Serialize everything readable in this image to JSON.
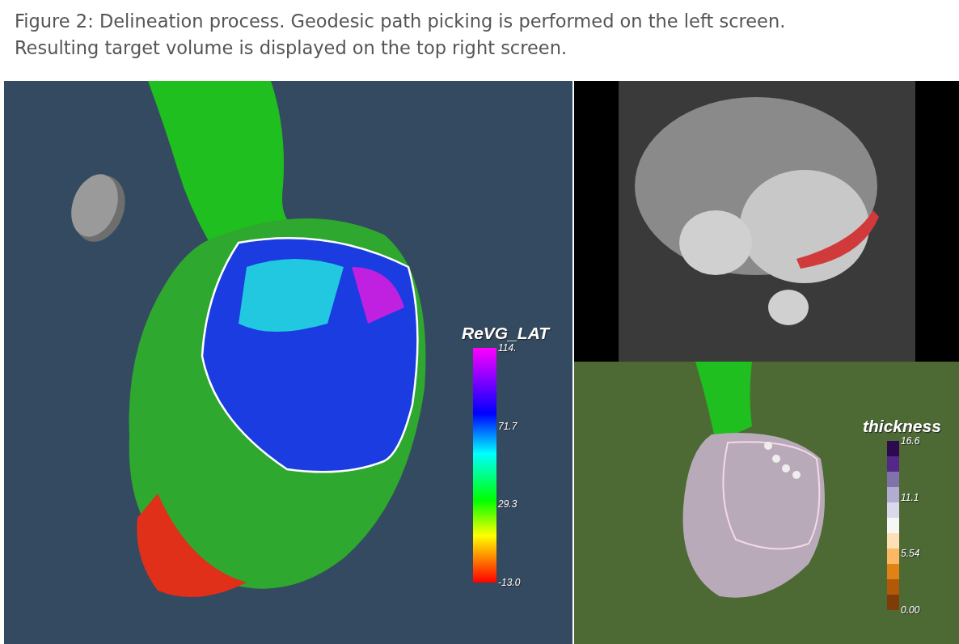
{
  "caption": {
    "lines": [
      "Figure 2: Delineation process. Geodesic path picking is performed on the left screen.",
      "Resulting target volume is displayed on the top right screen."
    ]
  },
  "left_view": {
    "legend": {
      "title": "ReVG_LAT",
      "ticks": [
        "114.",
        "71.7",
        "29.3",
        "-13.0"
      ]
    }
  },
  "bottom_right_view": {
    "legend": {
      "title": "thickness",
      "ticks": [
        "16.6",
        "11.1",
        "5.54",
        "0.00"
      ],
      "bins": [
        {
          "color": "#2d0a4e"
        },
        {
          "color": "#542788"
        },
        {
          "color": "#8073ac"
        },
        {
          "color": "#b2abd2"
        },
        {
          "color": "#d8daeb"
        },
        {
          "color": "#f7f7f7"
        },
        {
          "color": "#fee0b6"
        },
        {
          "color": "#fdb863"
        },
        {
          "color": "#e08214"
        },
        {
          "color": "#b35806"
        },
        {
          "color": "#7f3b08"
        }
      ]
    }
  }
}
